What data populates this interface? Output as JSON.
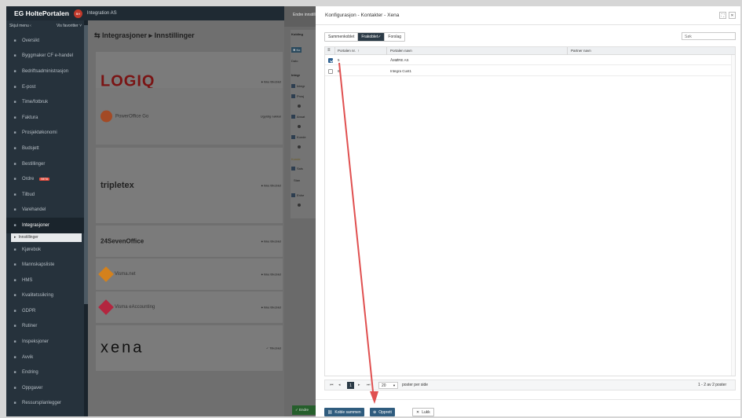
{
  "app": {
    "logo": "EG HoltePortalen",
    "tenant_initials": "BH",
    "tenant_name": "Integration AS"
  },
  "sidebar": {
    "menu_label": "Skjul menu",
    "show_all_label": "Vis favoritter",
    "items": [
      {
        "label": "Oversikt",
        "icon": "home-icon"
      },
      {
        "label": "Byggmaker CF e-handel",
        "icon": "cart-icon"
      },
      {
        "label": "Bedriftsadministrasjon",
        "icon": "building-icon"
      },
      {
        "label": "E-post",
        "icon": "mail-icon"
      },
      {
        "label": "Time/fotbruk",
        "icon": "clock-icon"
      },
      {
        "label": "Faktura",
        "icon": "document-icon"
      },
      {
        "label": "Prosjektøkonomi",
        "icon": "chart-icon"
      },
      {
        "label": "Budsjett",
        "icon": "budget-icon"
      },
      {
        "label": "Bestillinger",
        "icon": "order-icon"
      },
      {
        "label": "Ordre",
        "icon": "clipboard-icon",
        "badge": "BETA"
      },
      {
        "label": "Tilbud",
        "icon": "offer-icon"
      },
      {
        "label": "Varehandel",
        "icon": "shop-icon"
      },
      {
        "label": "Integrasjoner",
        "icon": "link-icon",
        "active": true
      },
      {
        "label": "Kjørebok",
        "icon": "car-icon"
      },
      {
        "label": "Mannskapsliste",
        "icon": "people-icon"
      },
      {
        "label": "HMS",
        "icon": "shield-icon"
      },
      {
        "label": "Kvalitetssikring",
        "icon": "check-icon"
      },
      {
        "label": "GDPR",
        "icon": "lock-icon"
      },
      {
        "label": "Rutiner",
        "icon": "book-icon"
      },
      {
        "label": "Inspeksjoner",
        "icon": "hardhat-icon"
      },
      {
        "label": "Avvik",
        "icon": "warning-icon"
      },
      {
        "label": "Endring",
        "icon": "swap-icon"
      },
      {
        "label": "Oppgaver",
        "icon": "task-icon"
      },
      {
        "label": "Ressursplanlegger",
        "icon": "calendar-icon"
      }
    ],
    "subitem": "Innstillinger"
  },
  "main": {
    "title": "Integrasjoner ▸ Innstillinger",
    "integrations": [
      {
        "name": "LOGIQ",
        "status": "Ikke tilkoblet"
      },
      {
        "name": "PowerOffice Go",
        "status": "Ugyldig nøkkel"
      },
      {
        "name": "tripletex",
        "status": "Ikke tilkoblet"
      },
      {
        "name": "24SevenOffice",
        "status": "Ikke tilkoblet"
      },
      {
        "name": "Visma.net",
        "status": "Ikke tilkoblet"
      },
      {
        "name": "Visma eAccounting",
        "status": "Ikke tilkoblet"
      },
      {
        "name": "xena",
        "status": "Tilkoblet"
      }
    ]
  },
  "mid_panel": {
    "header": "Endre innstillinger",
    "labels": [
      "Kobling",
      "Dato",
      "Integr",
      "Integr",
      "Prosj",
      "Ansat",
      "Kunde",
      "Kunde",
      "Sals",
      "Stan",
      "Enhe"
    ],
    "save_label": "Endre"
  },
  "modal": {
    "title": "Konfigurasjon - Kontakter - Xena",
    "filters": [
      "Sammenkoblet",
      "Frakoblet",
      "Forslag"
    ],
    "selected_filter": "Frakoblet",
    "search_placeholder": "Søk",
    "columns": [
      "Portalen nr.",
      "Portalen navn",
      "Partner navn"
    ],
    "rows": [
      {
        "checked": true,
        "nr": "5",
        "name": "ÅMØRE AS",
        "partner": ""
      },
      {
        "checked": false,
        "nr": "6",
        "name": "Integra Cust1",
        "partner": ""
      }
    ],
    "pager": {
      "current_page": "1",
      "page_size": "20",
      "per_page_label": "poster per side",
      "summary": "1 - 2 av 2 poster"
    },
    "footer": {
      "link_label": "Koble sammen",
      "create_label": "Opprett",
      "close_label": "Lukk"
    }
  },
  "colors": {
    "sidebar_bg": "#26323c",
    "primary": "#2f5c7e",
    "selected_filter": "#2b3a46",
    "arrow": "#e05050"
  }
}
